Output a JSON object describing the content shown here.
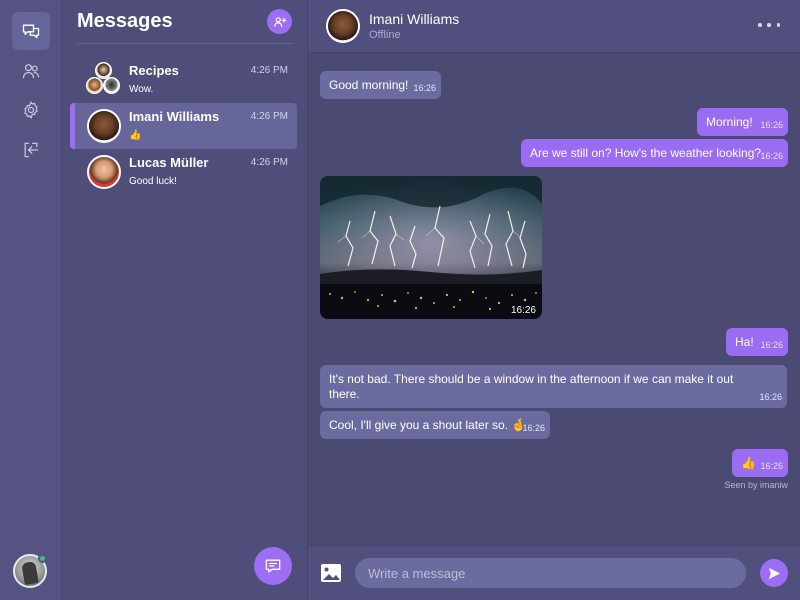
{
  "sidebar": {
    "items": [
      {
        "name": "chats",
        "icon": "chat-bubbles-icon",
        "active": true
      },
      {
        "name": "contacts",
        "icon": "users-icon",
        "active": false
      },
      {
        "name": "settings",
        "icon": "gear-icon",
        "active": false
      },
      {
        "name": "logout",
        "icon": "sign-out-icon",
        "active": false
      }
    ],
    "user": {
      "status": "online",
      "status_color": "#2ecc71"
    }
  },
  "conversations": {
    "title": "Messages",
    "new_group_icon": "add-user-icon",
    "compose_icon": "new-message-icon",
    "items": [
      {
        "name": "Recipes",
        "time": "4:26 PM",
        "preview": "Wow.",
        "active": false,
        "type": "group"
      },
      {
        "name": "Imani Williams",
        "time": "4:26 PM",
        "preview": "👍",
        "active": true
      },
      {
        "name": "Lucas Müller",
        "time": "4:26 PM",
        "preview": "Good luck!",
        "active": false
      }
    ]
  },
  "chat": {
    "header": {
      "name": "Imani Williams",
      "status": "Offline",
      "more_icon": "more-dots-icon"
    },
    "messages": [
      {
        "direction": "in",
        "type": "text",
        "text": "Good morning!",
        "time": "16:26"
      },
      {
        "direction": "out",
        "type": "text",
        "text": "Morning!",
        "time": "16:26"
      },
      {
        "direction": "out",
        "type": "text",
        "text": "Are we still on? How's the weather looking?",
        "time": "16:26"
      },
      {
        "direction": "in",
        "type": "image",
        "image": "lightning-storm-over-city-photo",
        "time": "16:26"
      },
      {
        "direction": "out",
        "type": "text",
        "text": "Ha!",
        "time": "16:26"
      },
      {
        "direction": "in",
        "type": "text",
        "text": "It's not bad. There should be a window in the afternoon if we can make it out there.",
        "time": "16:26"
      },
      {
        "direction": "in",
        "type": "text",
        "text": "Cool, I'll give you a shout later so. 🤞",
        "time": "16:26"
      },
      {
        "direction": "out",
        "type": "text",
        "text": "👍",
        "time": "16:26"
      }
    ],
    "seen": "Seen by imaniw"
  },
  "composer": {
    "placeholder": "Write a message",
    "value": "",
    "image_icon": "image-icon",
    "send_icon": "send-icon"
  },
  "colors": {
    "accent": "#9b6ef3",
    "background": "#4b4a72",
    "incoming_bubble": "#6c6b9f",
    "outgoing_bubble": "#9a6cf1"
  }
}
